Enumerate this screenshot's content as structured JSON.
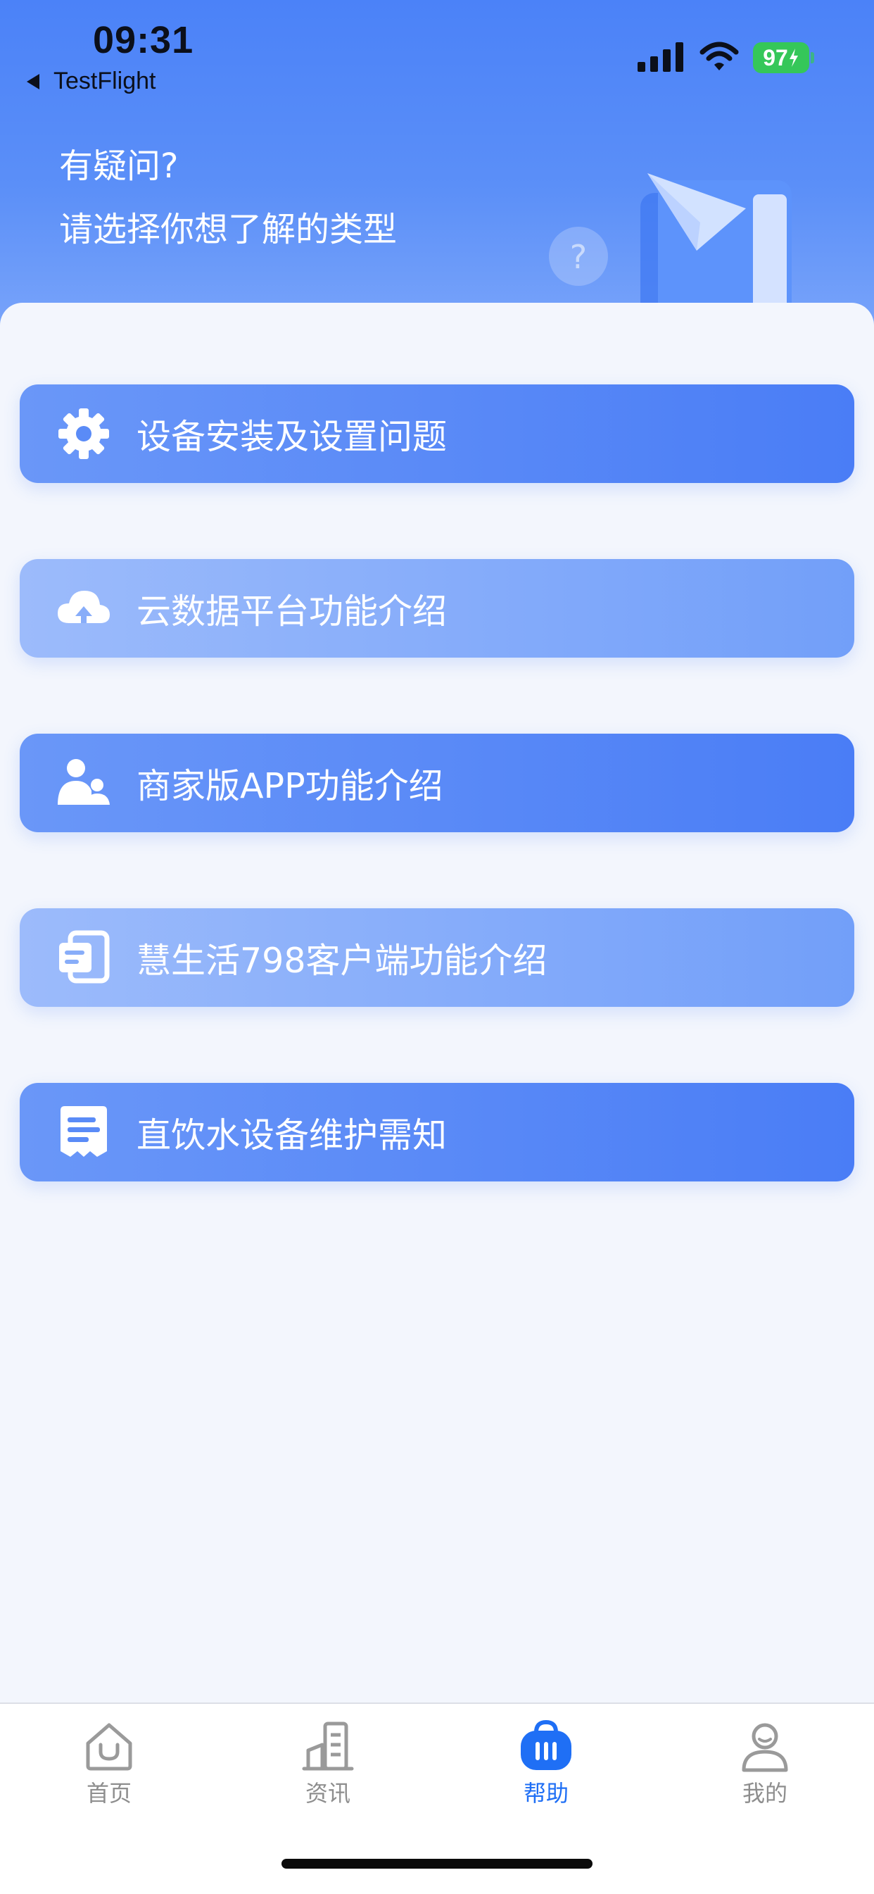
{
  "status_bar": {
    "time": "09:31",
    "back_label": "TestFlight",
    "battery": "97"
  },
  "header": {
    "line1": "有疑问?",
    "line2": "请选择你想了解的类型"
  },
  "menu": {
    "items": [
      {
        "label": "设备安装及设置问题",
        "icon": "gear-icon"
      },
      {
        "label": "云数据平台功能介绍",
        "icon": "cloud-upload-icon"
      },
      {
        "label": "商家版APP功能介绍",
        "icon": "users-icon"
      },
      {
        "label": "慧生活798客户端功能介绍",
        "icon": "document-copy-icon"
      },
      {
        "label": "直饮水设备维护需知",
        "icon": "note-icon"
      }
    ]
  },
  "tabbar": {
    "tabs": [
      {
        "label": "首页",
        "icon": "home-icon"
      },
      {
        "label": "资讯",
        "icon": "news-building-icon"
      },
      {
        "label": "帮助",
        "icon": "help-bag-icon"
      },
      {
        "label": "我的",
        "icon": "user-icon"
      }
    ],
    "active_index": 2
  },
  "colors": {
    "accent": "#1f6ff5",
    "header_top": "#4b82f8",
    "card_dark": "#4a7df6",
    "card_light": "#9cbbfb",
    "battery_green": "#35c759",
    "tab_inactive": "#8e8e8e"
  }
}
